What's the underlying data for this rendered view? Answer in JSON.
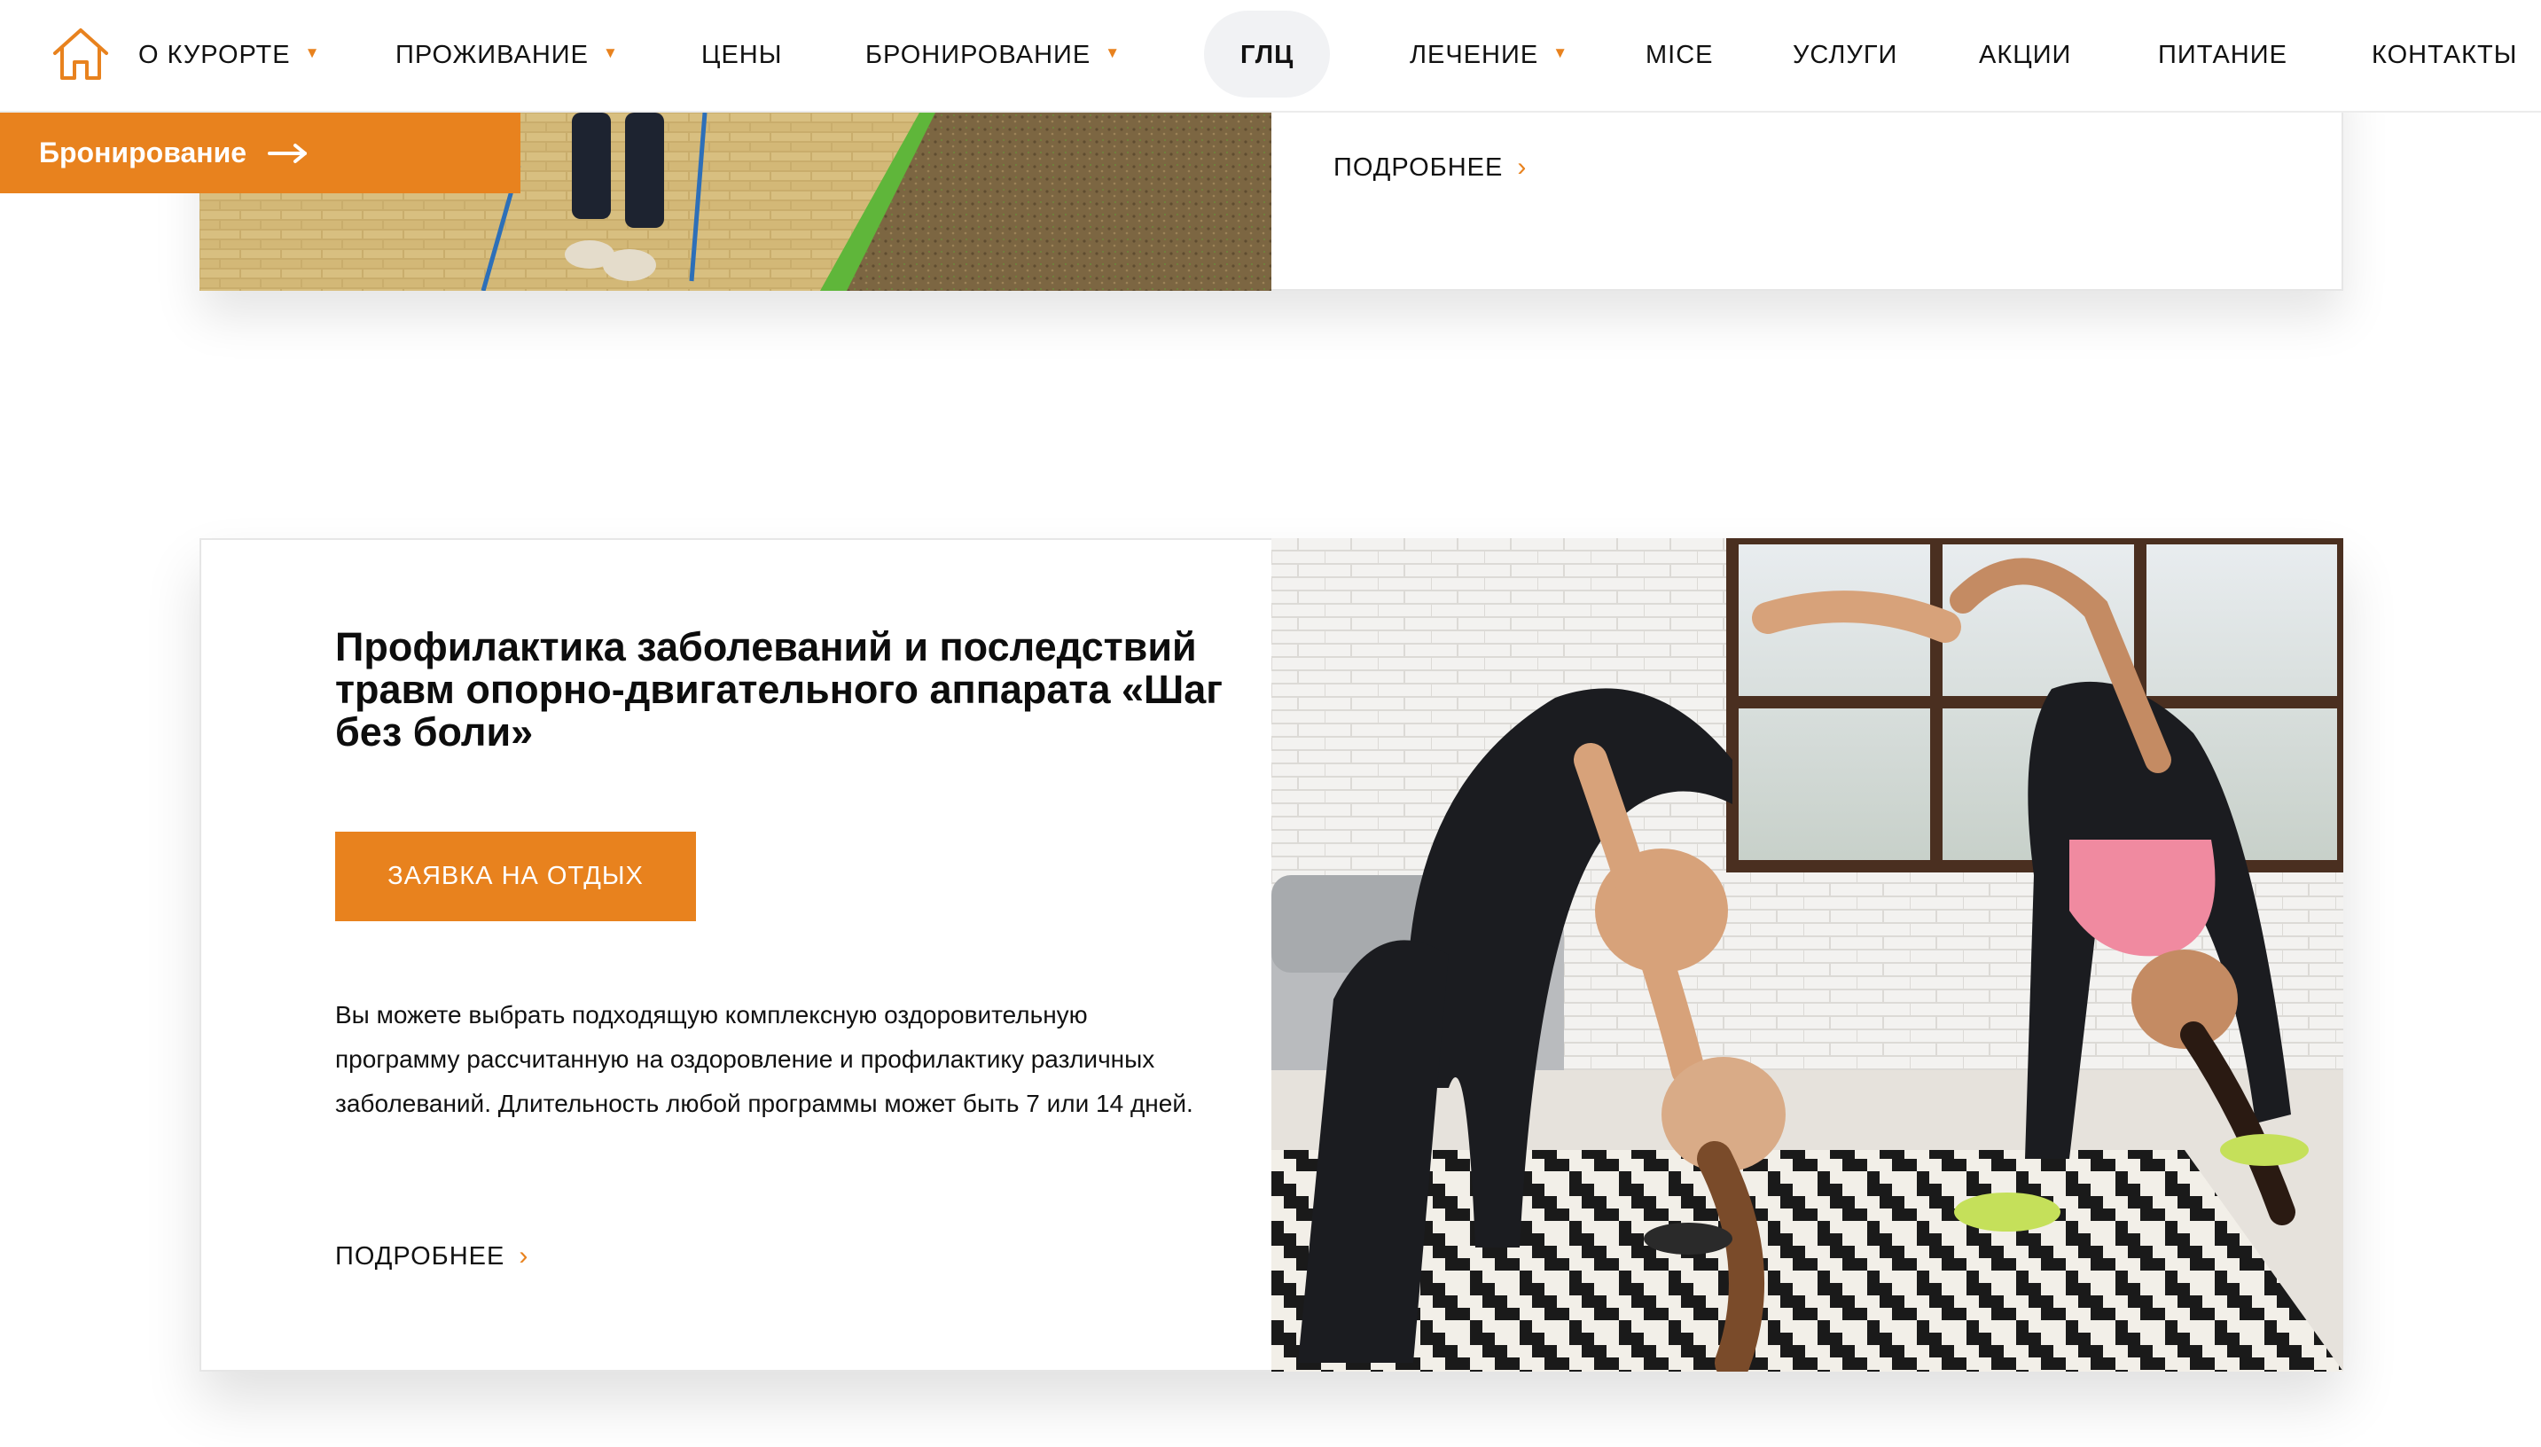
{
  "nav": {
    "home_icon": "home-icon",
    "items": [
      {
        "label": "О КУРОРТЕ",
        "dropdown": true
      },
      {
        "label": "ПРОЖИВАНИЕ",
        "dropdown": true
      },
      {
        "label": "ЦЕНЫ",
        "dropdown": false
      },
      {
        "label": "БРОНИРОВАНИЕ",
        "dropdown": true
      },
      {
        "label": "ГЛЦ",
        "dropdown": false,
        "active": true
      },
      {
        "label": "ЛЕЧЕНИЕ",
        "dropdown": true
      },
      {
        "label": "MICE",
        "dropdown": false
      },
      {
        "label": "УСЛУГИ",
        "dropdown": false
      },
      {
        "label": "АКЦИИ",
        "dropdown": false
      },
      {
        "label": "ПИТАНИЕ",
        "dropdown": false
      },
      {
        "label": "КОНТАКТЫ",
        "dropdown": false
      }
    ],
    "caret": "▼"
  },
  "booking_tab": {
    "label": "Бронирование",
    "icon": "arrow-right-icon"
  },
  "prev_card": {
    "more_label": "ПОДРОБНЕЕ",
    "chevron": "›"
  },
  "card": {
    "title": "Профилактика заболеваний и последствий травм опорно-двигательного аппарата «Шаг без боли»",
    "cta_label": "ЗАЯВКА НА ОТДЫХ",
    "text": "Вы можете выбрать подходящую комплексную оздоровительную программу рассчитанную на оздоровление и профилактику различных заболеваний. Длительность любой программы может быть 7 или 14 дней.",
    "more_label": "ПОДРОБНЕЕ",
    "chevron": "›"
  },
  "colors": {
    "accent": "#e8821e",
    "pill": "#f1f2f4",
    "border": "#e6e6e6"
  }
}
